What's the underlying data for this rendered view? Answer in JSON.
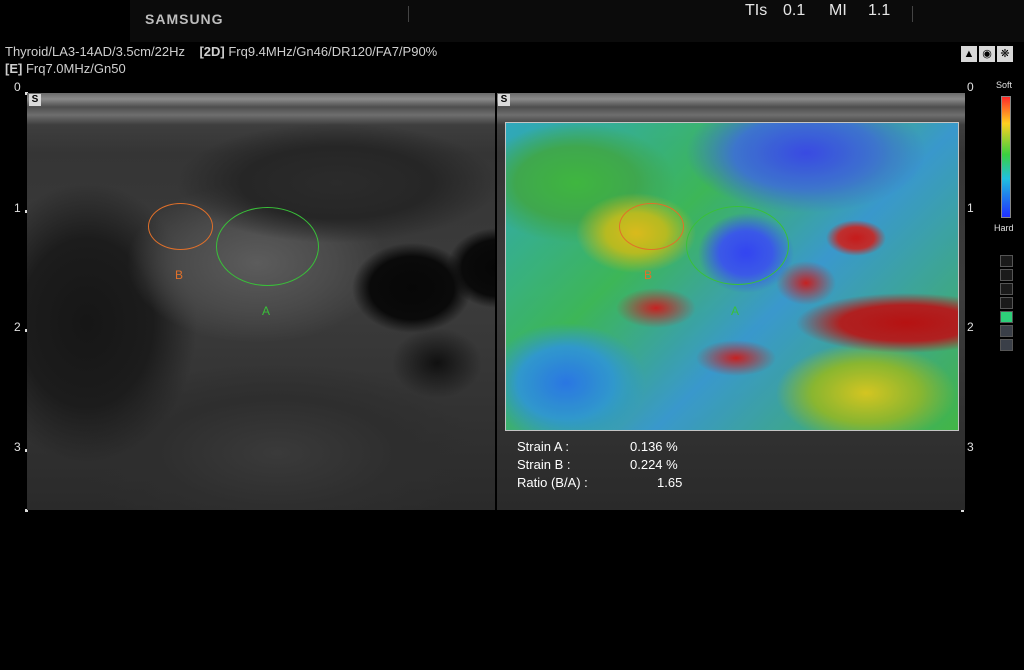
{
  "header": {
    "brand": "SAMSUNG",
    "tis_label": "TIs",
    "tis_value": "0.1",
    "mi_label": "MI",
    "mi_value": "1.1"
  },
  "params": {
    "preset": "Thyroid",
    "probe": "LA3-14AD",
    "depth": "3.5cm",
    "frame_rate": "22Hz",
    "mode_2d": "[2D]",
    "frq": "Frq9.4MHz",
    "gain": "Gn46",
    "dr": "DR120",
    "fa": "FA7",
    "power": "P90%",
    "mode_e": "[E]",
    "e_frq": "Frq7.0MHz",
    "e_gain": "Gn50"
  },
  "depth_scale": {
    "left_ticks": [
      "0",
      "1",
      "2",
      "3"
    ],
    "right_ticks": [
      "0",
      "1",
      "2",
      "3"
    ]
  },
  "panels": {
    "left_badge": "S",
    "right_badge": "S"
  },
  "rois": {
    "a_label": "A",
    "b_label": "B"
  },
  "measurements": {
    "strain_a_label": "Strain A :",
    "strain_a_value": "0.136 %",
    "strain_b_label": "Strain B :",
    "strain_b_value": "0.224 %",
    "ratio_label": "Ratio (B/A) :",
    "ratio_value": "1.65"
  },
  "colorbar": {
    "top_label": "Soft",
    "bottom_label": "Hard",
    "colors": [
      "#ff2a2a",
      "#ffd020",
      "#3ad040",
      "#20c0e0",
      "#2030ff"
    ]
  },
  "quality_indicator": {
    "levels": 6,
    "active_level": 4
  },
  "toolbar_icons": [
    "probe-icon",
    "cine-icon",
    "settings-icon"
  ]
}
